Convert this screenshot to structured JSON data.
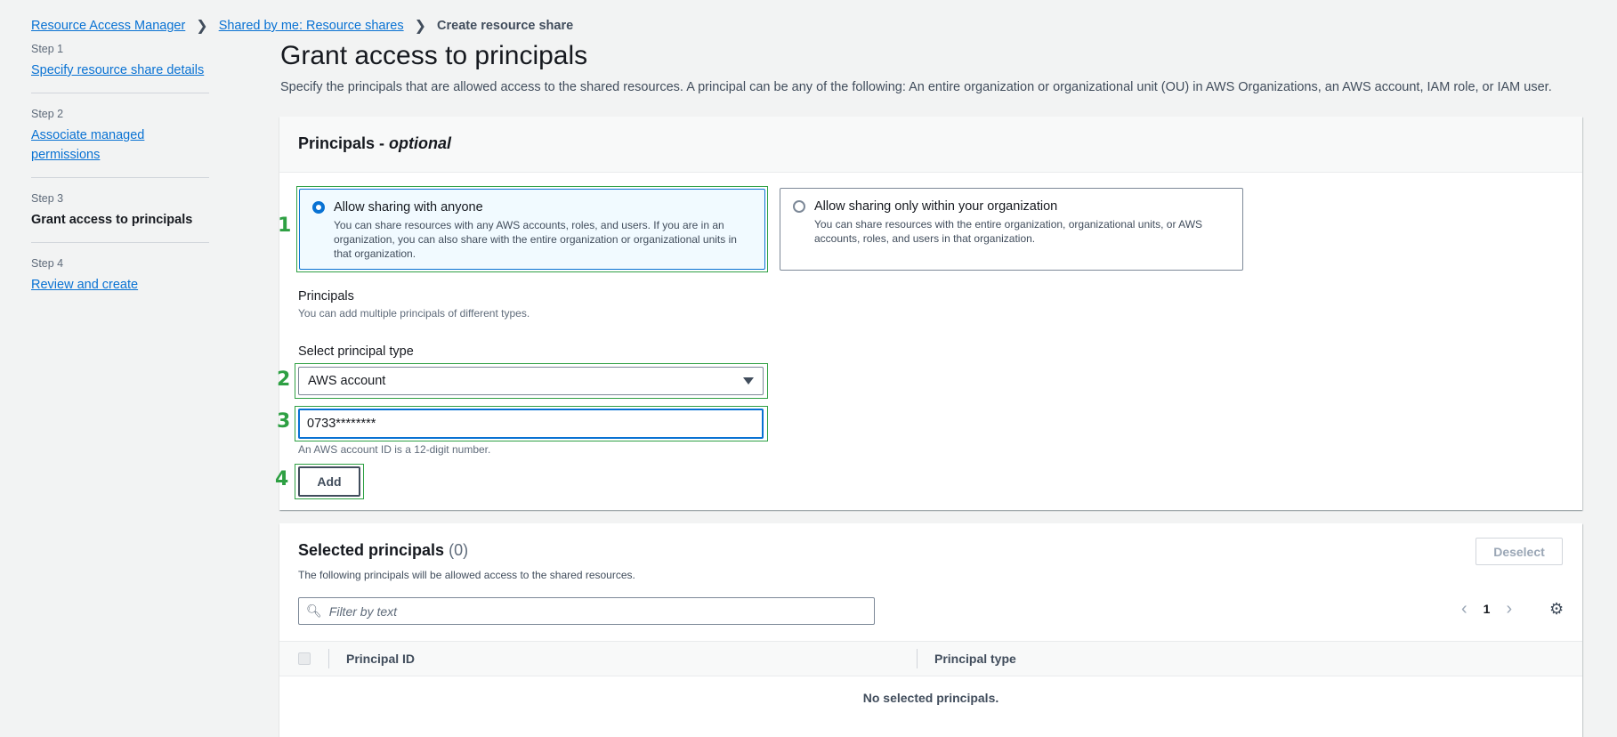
{
  "breadcrumb": {
    "items": [
      "Resource Access Manager",
      "Shared by me: Resource shares"
    ],
    "current": "Create resource share"
  },
  "steps": [
    {
      "num": "Step 1",
      "title": "Specify resource share details"
    },
    {
      "num": "Step 2",
      "title": "Associate managed permissions"
    },
    {
      "num": "Step 3",
      "title": "Grant access to principals"
    },
    {
      "num": "Step 4",
      "title": "Review and create"
    }
  ],
  "main": {
    "title": "Grant access to principals",
    "description": "Specify the principals that are allowed access to the shared resources. A principal can be any of the following: An entire organization or organizational unit (OU) in AWS Organizations, an AWS account, IAM role, or IAM user."
  },
  "principals_panel": {
    "title": "Principals - ",
    "title_suffix": "optional",
    "option_anyone": {
      "label": "Allow sharing with anyone",
      "desc": "You can share resources with any AWS accounts, roles, and users. If you are in an organization, you can also share with the entire organization or organizational units in that organization."
    },
    "option_org": {
      "label": "Allow sharing only within your organization",
      "desc": "You can share resources with the entire organization, organizational units, or AWS accounts, roles, and users in that organization."
    },
    "principals_label": "Principals",
    "principals_desc": "You can add multiple principals of different types.",
    "select_label": "Select principal type",
    "select_value": "AWS account",
    "input_value": "0733********",
    "input_hint": "An AWS account ID is a 12-digit number.",
    "add_button": "Add"
  },
  "annotations": [
    "1",
    "2",
    "3",
    "4"
  ],
  "selected_panel": {
    "title": "Selected principals",
    "count": "(0)",
    "desc": "The following principals will be allowed access to the shared resources.",
    "deselect_button": "Deselect",
    "filter_placeholder": "Filter by text",
    "page": "1",
    "columns": [
      "Principal ID",
      "Principal type"
    ],
    "empty": "No selected principals."
  }
}
